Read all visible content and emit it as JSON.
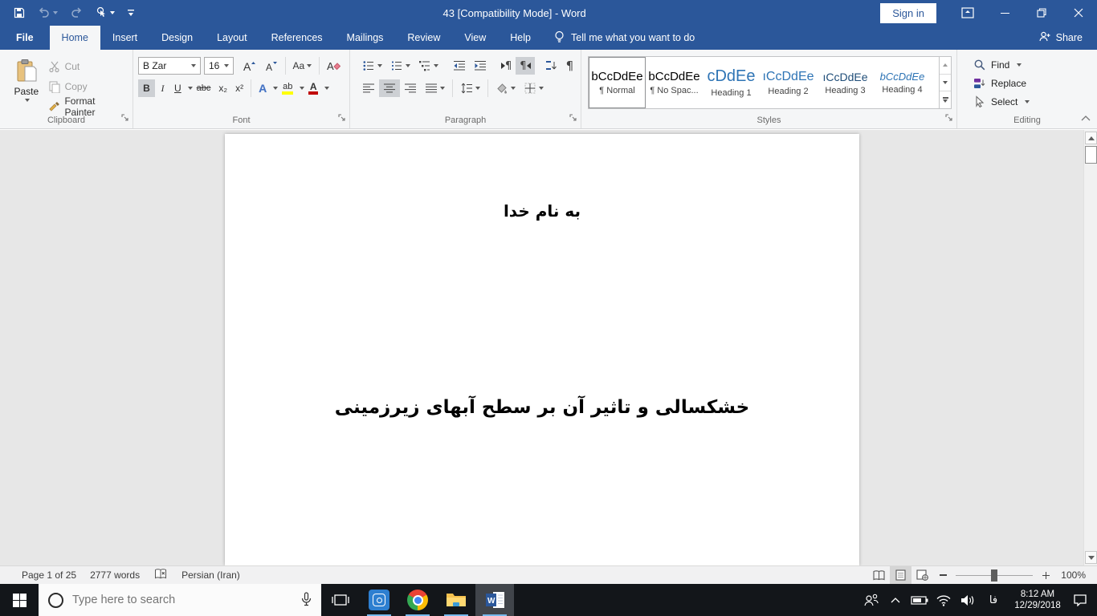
{
  "colors": {
    "accent": "#2B579A",
    "heading_blue": "#2E74B5",
    "taskbar_underline": "#76B9ED",
    "highlight_yellow": "#FFFF00",
    "font_color_red": "#C00000"
  },
  "titlebar": {
    "title": "43 [Compatibility Mode]  -  Word",
    "sign_in": "Sign in"
  },
  "tabs": {
    "items": [
      "File",
      "Home",
      "Insert",
      "Design",
      "Layout",
      "References",
      "Mailings",
      "Review",
      "View",
      "Help"
    ],
    "active": "Home",
    "tell_me": "Tell me what you want to do",
    "share": "Share"
  },
  "ribbon": {
    "clipboard": {
      "label": "Clipboard",
      "paste": "Paste",
      "cut": "Cut",
      "copy": "Copy",
      "format_painter": "Format Painter"
    },
    "font": {
      "label": "Font",
      "family": "B Zar",
      "size": "16",
      "bold": "B",
      "italic": "I",
      "underline": "U",
      "strikethrough": "abc",
      "subscript": "x₂",
      "superscript": "x²",
      "change_case": "Aa",
      "text_effects": "A",
      "highlight": "ab",
      "font_color": "A"
    },
    "paragraph": {
      "label": "Paragraph",
      "pilcrow": "¶"
    },
    "styles": {
      "label": "Styles",
      "items": [
        {
          "preview": "bCcDdEe",
          "name": "¶ Normal"
        },
        {
          "preview": "bCcDdEe",
          "name": "¶ No Spac..."
        },
        {
          "preview": "cDdEe",
          "name": "Heading 1"
        },
        {
          "preview": "ıCcDdEe",
          "name": "Heading 2"
        },
        {
          "preview": "ıCcDdEe",
          "name": "Heading 3"
        },
        {
          "preview": "bCcDdEe",
          "name": "Heading 4"
        }
      ]
    },
    "editing": {
      "label": "Editing",
      "find": "Find",
      "replace": "Replace",
      "select": "Select"
    }
  },
  "document": {
    "line1": "به نام خدا",
    "line2": "خشکسالی و تاثیر آن بر سطح آبهای زیرزمینی"
  },
  "status_bar": {
    "page": "Page 1 of 25",
    "words": "2777 words",
    "language": "Persian (Iran)",
    "zoom": "100%"
  },
  "taskbar": {
    "search_placeholder": "Type here to search",
    "language": "فا",
    "time": "8:12 AM",
    "date": "12/29/2018"
  },
  "icons": {
    "quick_access": [
      "save-icon",
      "undo-icon",
      "redo-icon",
      "touch-mode-icon",
      "customize-qat-icon"
    ],
    "window": [
      "ribbon-display-icon",
      "minimize-icon",
      "restore-icon",
      "close-icon"
    ],
    "tray": [
      "people-icon",
      "hidden-icons-chevron",
      "battery-icon",
      "wifi-icon",
      "speaker-icon",
      "action-center-icon"
    ]
  }
}
